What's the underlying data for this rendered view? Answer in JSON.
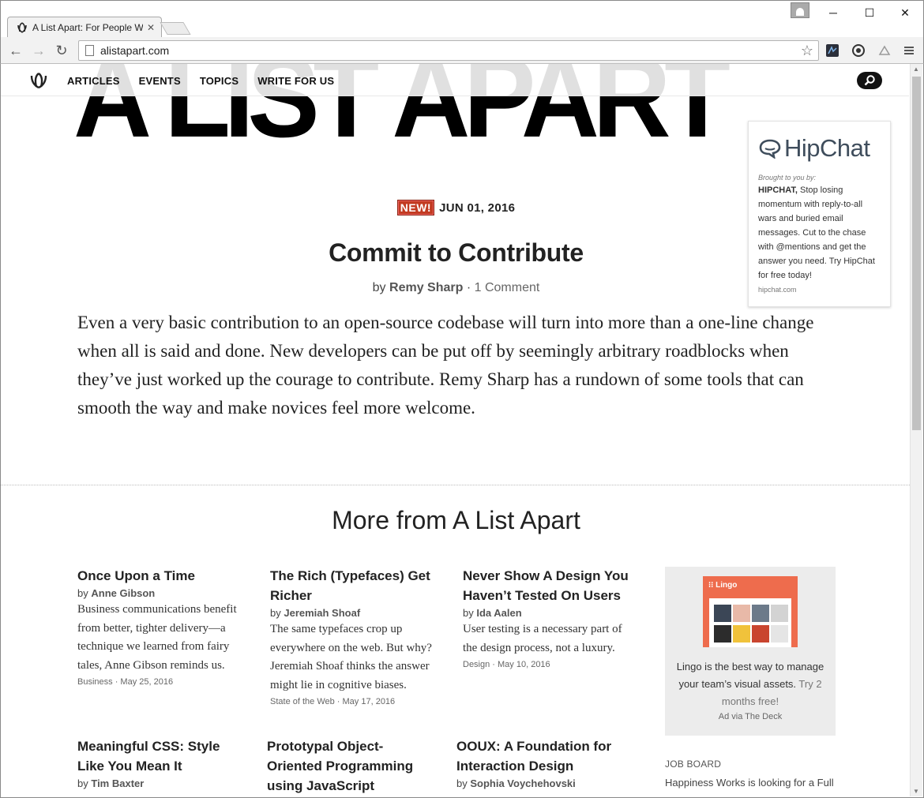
{
  "browser": {
    "tab_title": "A List Apart: For People W",
    "tab_close": "✕",
    "url": "alistapart.com",
    "window_controls": {
      "minimize": "─",
      "maximize": "☐",
      "close": "✕"
    },
    "nav": {
      "back": "←",
      "forward": "→",
      "reload": "↻",
      "star": "☆"
    }
  },
  "site": {
    "masthead": "A LIST APART",
    "nav_items": [
      "ARTICLES",
      "EVENTS",
      "TOPICS",
      "WRITE FOR US"
    ]
  },
  "sponsor": {
    "brand": "HipChat",
    "brought_by": "Brought to you by:",
    "brand_bold": "HIPCHAT,",
    "text": " Stop losing momentum with reply-to-all wars and buried email messages. Cut to the chase with @mentions and get the answer you need. Try HipChat for free today!",
    "domain": "hipchat.com"
  },
  "feature": {
    "badge": "NEW!",
    "date": "JUN 01, 2016",
    "title": "Commit to Contribute",
    "by": "by",
    "author": "Remy Sharp",
    "separator": "·",
    "comments": "1 Comment",
    "excerpt": "Even a very basic contribution to an open-source codebase will turn into more than a one-line change when all is said and done. New developers can be put off by seemingly arbitrary roadblocks when they’ve just worked up the courage to contribute. Remy Sharp has a rundown of some tools that can smooth the way and make novices feel more welcome."
  },
  "more": {
    "heading": "More from A List Apart",
    "cards": [
      {
        "title": "Once Upon a Time",
        "by": "by",
        "author": "Anne Gibson",
        "desc": "Business communications benefit from better, tighter delivery—a technique we learned from fairy tales, Anne Gibson reminds us.",
        "meta": "Business · May 25, 2016"
      },
      {
        "title": "The Rich (Typefaces) Get Richer",
        "by": "by",
        "author": "Jeremiah Shoaf",
        "desc": "The same typefaces crop up everywhere on the web. But why? Jeremiah Shoaf thinks the answer might lie in cognitive biases.",
        "meta": "State of the Web · May 17, 2016"
      },
      {
        "title": "Never Show A Design You Haven’t Tested On Users",
        "by": "by",
        "author": "Ida Aalen",
        "desc": "User testing is a necessary part of the design process, not a luxury.",
        "meta": "Design · May 10, 2016"
      },
      {
        "title": "Meaningful CSS: Style Like You Mean It",
        "by": "by",
        "author": "Tim Baxter",
        "desc": "",
        "meta": ""
      },
      {
        "title": "Prototypal Object-Oriented Programming using JavaScript",
        "by": "",
        "author": "",
        "desc": "",
        "meta": ""
      },
      {
        "title": "OOUX: A Foundation for Interaction Design",
        "by": "by",
        "author": "Sophia Voychehovski",
        "desc": "",
        "meta": ""
      }
    ]
  },
  "deck_ad": {
    "image_label": "⁝⁝ Lingo",
    "text": "Lingo is the best way to manage your team’s visual assets.",
    "try": " Try 2 months free!",
    "via": "Ad via The Deck"
  },
  "job_board": {
    "label": "JOB BOARD",
    "item": "Happiness Works is looking for a Full"
  },
  "colors": {
    "badge": "#c23b22",
    "lingo": "#ee6c4d",
    "hipchat": "#3f4d5c"
  }
}
